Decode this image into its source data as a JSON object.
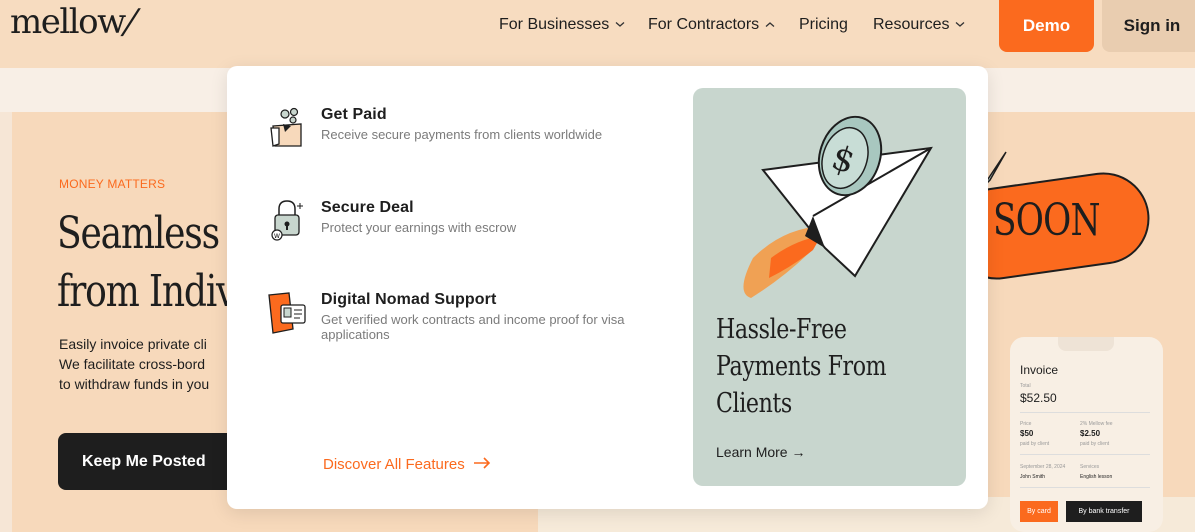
{
  "header": {
    "logo": "mellow",
    "nav": [
      {
        "label": "For Businesses",
        "chevron": "⌄"
      },
      {
        "label": "For Contractors",
        "chevron": "⌃"
      },
      {
        "label": "Pricing"
      },
      {
        "label": "Resources",
        "chevron": "⌄"
      }
    ],
    "demo_label": "Demo",
    "signin_label": "Sign in"
  },
  "hero": {
    "eyebrow": "MONEY MATTERS",
    "headline_line1": "Seamless",
    "headline_line2": "from Indiv",
    "para_line1": "Easily invoice private cli",
    "para_line2": "We facilitate cross-bord",
    "para_line3": "to withdraw funds in you",
    "cta_label": "Keep Me Posted",
    "soon_text": "SOON"
  },
  "invoice": {
    "title": "Invoice",
    "total_label": "Total",
    "total": "$52.50",
    "price_label": "Price",
    "price": "$50",
    "price_sub": "paid by client",
    "fee_label": "2% Mellow fee",
    "fee": "$2.50",
    "fee_sub": "paid by client",
    "date": "September 28, 2024",
    "name": "John Smith",
    "services_label": "Services",
    "services": "English lesson",
    "btn_card": "By card",
    "btn_bank": "By bank transfer"
  },
  "dropdown": {
    "features": [
      {
        "title": "Get Paid",
        "desc": "Receive secure payments from clients worldwide",
        "icon": "wallet-coins-icon"
      },
      {
        "title": "Secure Deal",
        "desc": "Protect your earnings with escrow",
        "icon": "padlock-icon"
      },
      {
        "title": "Digital Nomad Support",
        "desc": "Get verified work contracts and income proof for visa applications",
        "icon": "id-card-icon"
      }
    ],
    "discover_label": "Discover All Features",
    "promo_title_line1": "Hassle-Free",
    "promo_title_line2": "Payments From",
    "promo_title_line3": "Clients",
    "promo_link": "Learn More →"
  },
  "colors": {
    "accent": "#fb6a1e",
    "header_bg": "#f7dcc0",
    "promo_bg": "#c8d6ce",
    "dark": "#1e1e1e"
  }
}
